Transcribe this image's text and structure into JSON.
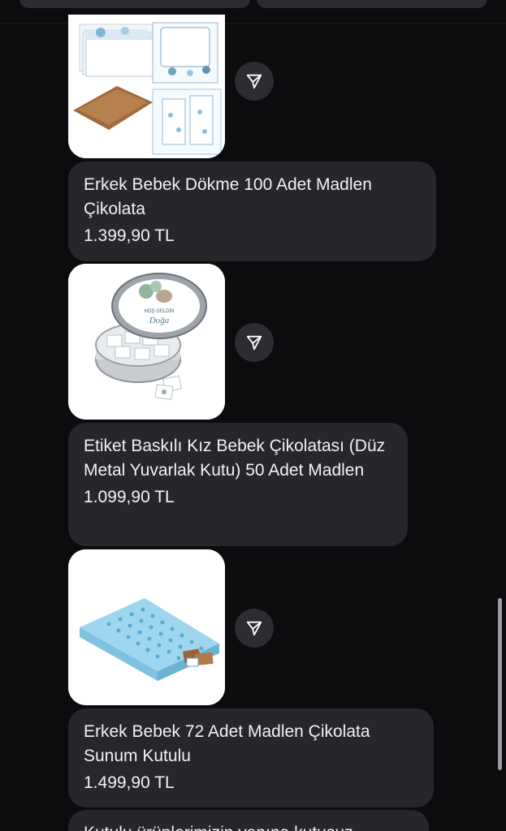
{
  "products": [
    {
      "name": "Erkek Bebek Dökme 100 Adet Madlen Çikolata",
      "price": "1.399,90 TL",
      "image_desc": "chocolate boxes"
    },
    {
      "name": "Etiket Baskılı Kız Bebek Çikolatası (Düz Metal Yuvarlak Kutu) 50 Adet Madlen",
      "price": "1.099,90 TL",
      "tin_label_line1": "HOŞ GELDİN",
      "tin_label_line2": "Doğa"
    },
    {
      "name": "Erkek Bebek 72 Adet Madlen Çikolata Sunum Kutulu",
      "price": "1.499,90 TL"
    }
  ],
  "partial_message": "Kutulu ürünlerimizin yanına kutusuz",
  "icons": {
    "share": "send-paper-plane-icon"
  },
  "colors": {
    "background": "#0c0c0e",
    "bubble": "#26262b",
    "share_button": "#2c2c31"
  }
}
